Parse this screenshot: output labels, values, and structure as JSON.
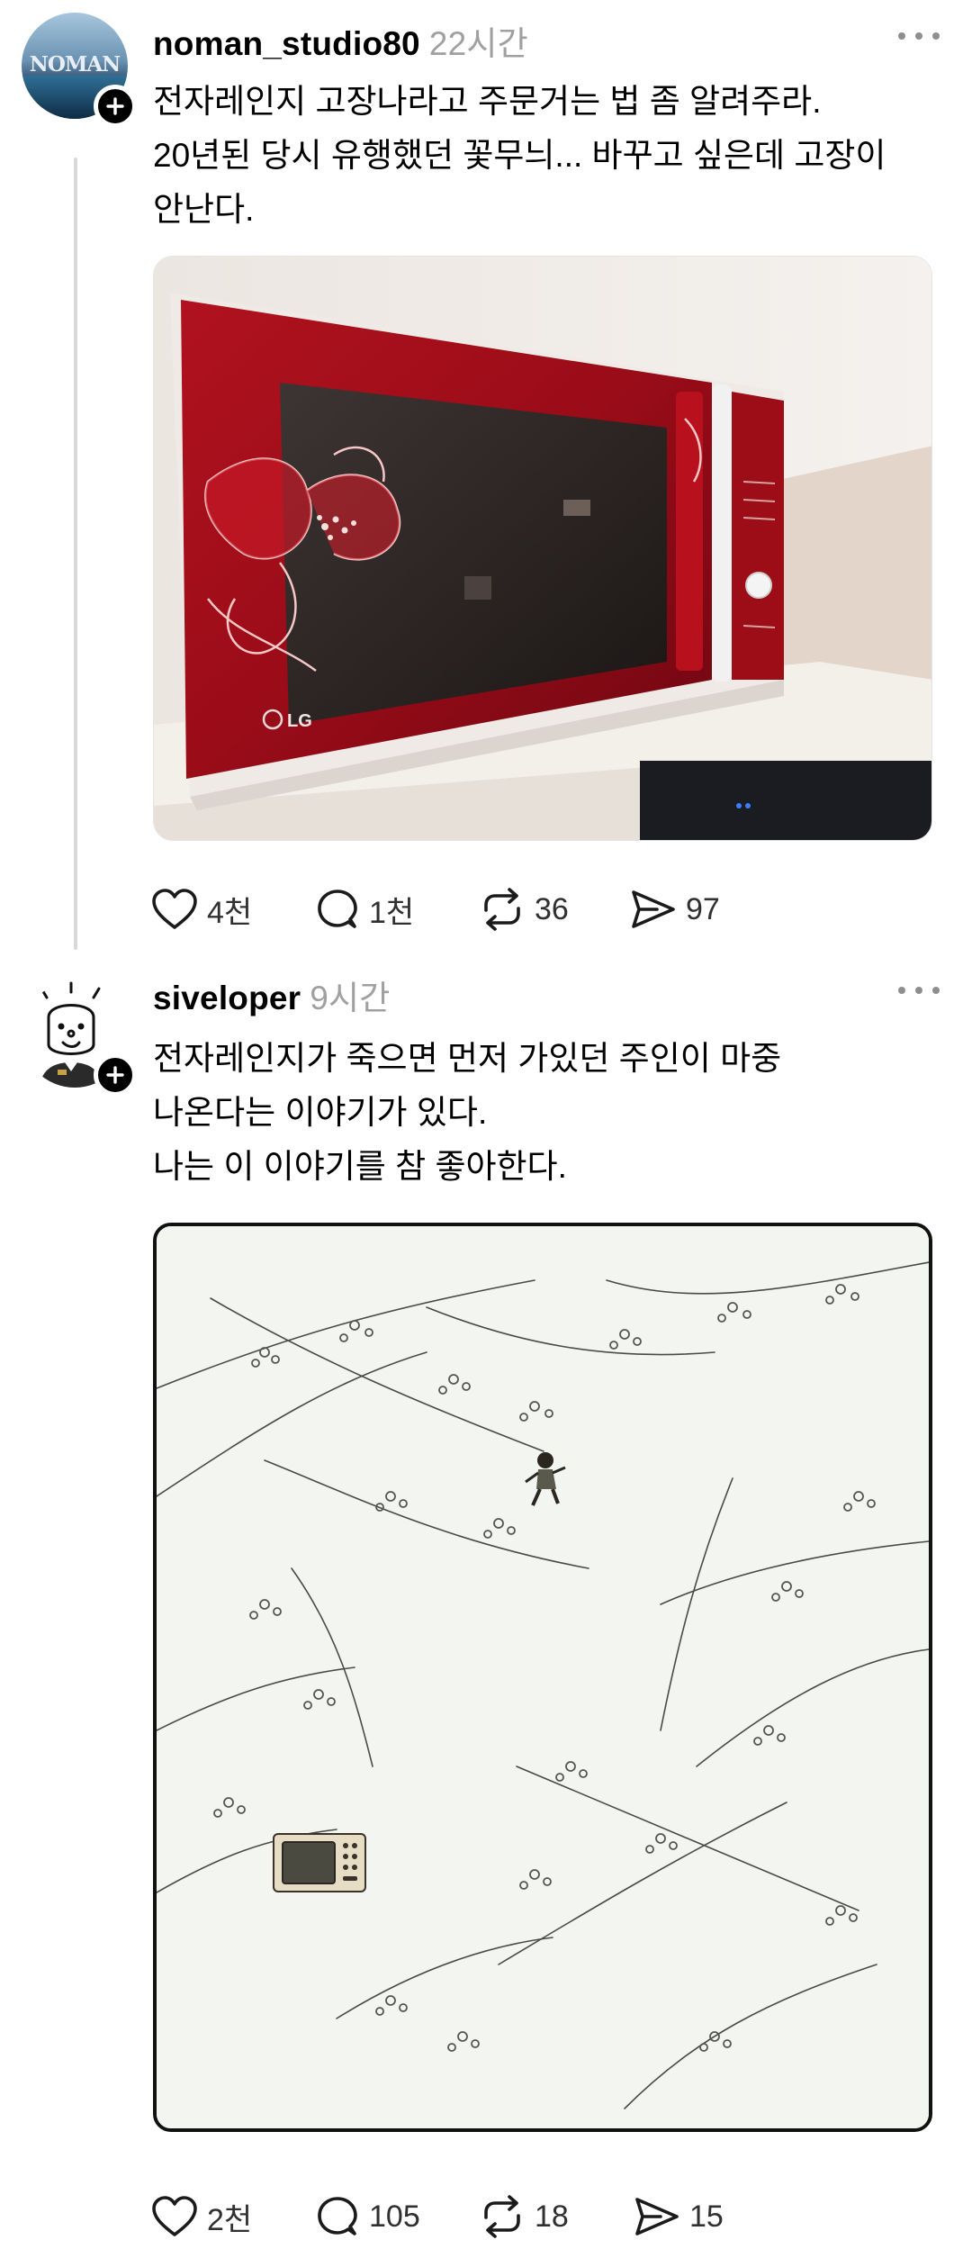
{
  "posts": [
    {
      "username": "noman_studio80",
      "time_ago": "22시간",
      "avatar_text": "NOMAN",
      "text_lines": [
        "전자레인지 고장나라고 주문거는 법 좀 알려주라.",
        "20년된 당시 유행했던 꽃무늬... 바꾸고 싶은데 고장이",
        "안난다."
      ],
      "image": {
        "brand_text": "LG"
      },
      "stats": {
        "likes": "4천",
        "comments": "1천",
        "reposts": "36",
        "shares": "97"
      }
    },
    {
      "username": "siveloper",
      "time_ago": "9시간",
      "text_lines": [
        "전자레인지가 죽으면 먼저 가있던 주인이 마중",
        "나온다는 이야기가 있다.",
        "나는 이 이야기를 참 좋아한다."
      ],
      "stats": {
        "likes": "2천",
        "comments": "105",
        "reposts": "18",
        "shares": "15"
      }
    }
  ]
}
